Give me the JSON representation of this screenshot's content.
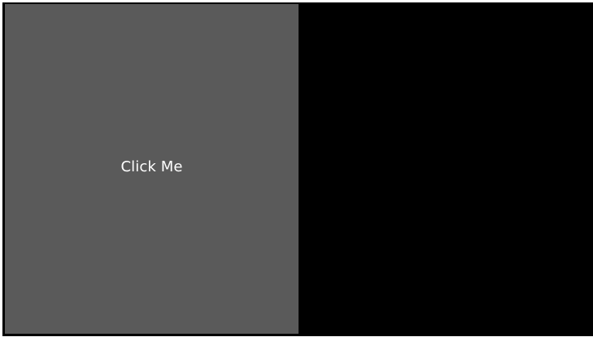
{
  "main": {
    "button_label": "Click Me"
  },
  "colors": {
    "button_bg": "#5a5a5a",
    "panel_bg": "#000000",
    "text": "#ffffff",
    "page_bg": "#ffffff"
  }
}
